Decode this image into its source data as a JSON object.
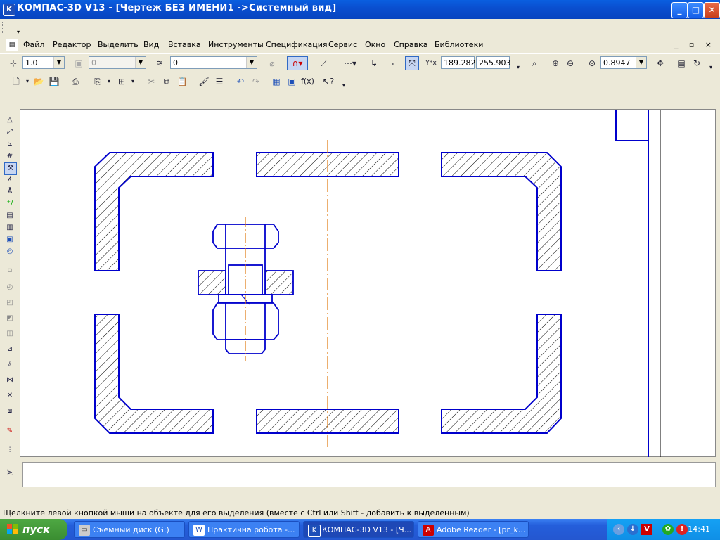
{
  "window": {
    "title": "КОМПАС-3D V13 - [Чертеж БЕЗ ИМЕНИ1 ->Системный вид]",
    "controls": {
      "minimize": "_",
      "maximize": "□",
      "close": "✕"
    }
  },
  "menu": {
    "items": [
      "Файл",
      "Редактор",
      "Выделить",
      "Вид",
      "Вставка",
      "Инструменты",
      "Спецификация",
      "Сервис",
      "Окно",
      "Справка",
      "Библиотеки"
    ],
    "mdi_controls": "_ ▫ ×"
  },
  "toolbar_current": {
    "scale_value": "1.0",
    "style_value": "0",
    "layer_value": "0",
    "coord_x": "189.282",
    "coord_y": "255.903",
    "zoom_value": "0.8947"
  },
  "status": {
    "hint": "Щелкните левой кнопкой мыши на объекте для его выделения (вместе с Ctrl или Shift - добавить к выделенным)"
  },
  "taskbar": {
    "start_label": "пуск",
    "tasks": [
      {
        "label": "Съемный диск (G:)",
        "icon": "drive-icon"
      },
      {
        "label": "Практична робота -...",
        "icon": "word-icon"
      },
      {
        "label": "КОМПАС-3D V13 - [Ч...",
        "icon": "kompas-icon"
      },
      {
        "label": "Adobe Reader - [pr_k...",
        "icon": "adobe-icon"
      }
    ],
    "clock": "14:41"
  },
  "colors": {
    "drawing_line": "#0000cc",
    "axis_line": "#e07a10",
    "hatch": "#000000"
  }
}
